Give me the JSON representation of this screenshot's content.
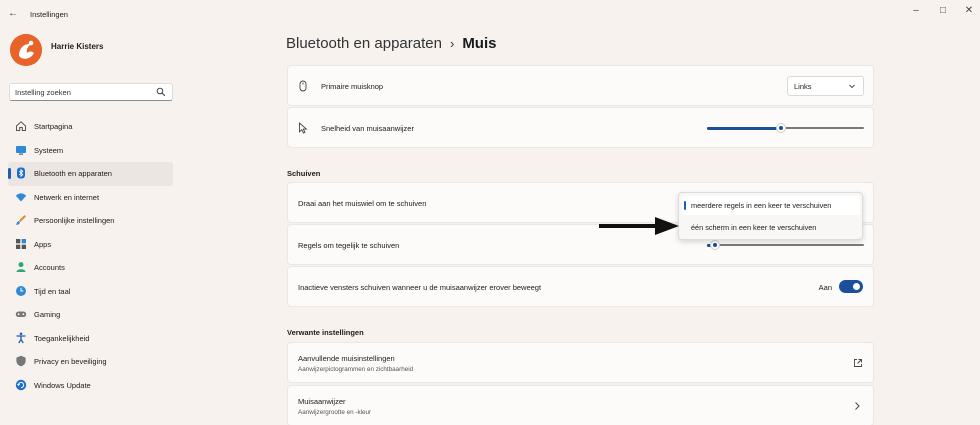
{
  "window": {
    "title": "Instellingen",
    "back_glyph": "←",
    "minimize_glyph": "–",
    "maximize_glyph": "□",
    "close_glyph": "✕"
  },
  "user": {
    "name": "Harrie Kisters"
  },
  "search": {
    "placeholder": "Instelling zoeken",
    "value": ""
  },
  "nav": {
    "items": [
      {
        "label": "Startpagina",
        "icon": "home-icon"
      },
      {
        "label": "Systeem",
        "icon": "monitor-icon"
      },
      {
        "label": "Bluetooth en apparaten",
        "icon": "bluetooth-icon",
        "active": true
      },
      {
        "label": "Netwerk en internet",
        "icon": "wifi-icon"
      },
      {
        "label": "Persoonlijke instellingen",
        "icon": "brush-icon"
      },
      {
        "label": "Apps",
        "icon": "apps-icon"
      },
      {
        "label": "Accounts",
        "icon": "person-icon"
      },
      {
        "label": "Tijd en taal",
        "icon": "globe-clock-icon"
      },
      {
        "label": "Gaming",
        "icon": "gamepad-icon"
      },
      {
        "label": "Toegankelijkheid",
        "icon": "accessibility-icon"
      },
      {
        "label": "Privacy en beveiliging",
        "icon": "shield-icon"
      },
      {
        "label": "Windows Update",
        "icon": "update-icon"
      }
    ]
  },
  "breadcrumb": {
    "parent": "Bluetooth en apparaten",
    "separator": "›",
    "current": "Muis"
  },
  "primary_button": {
    "label": "Primaire muisknop",
    "value": "Links",
    "icon": "mouse-icon"
  },
  "pointer_speed": {
    "label": "Snelheid van muisaanwijzer",
    "value": 0.47,
    "icon": "cursor-icon"
  },
  "scrolling": {
    "header": "Schuiven",
    "wheel_label": "Draai aan het muiswiel om te schuiven",
    "wheel_options": [
      "meerdere regels in een keer te verschuiven",
      "één scherm in een keer te verschuiven"
    ],
    "wheel_selected": 0,
    "lines_label": "Regels om tegelijk te schuiven",
    "lines_value": 0.05,
    "inactive_label": "Inactieve vensters schuiven wanneer u de muisaanwijzer erover beweegt",
    "inactive_state": "Aan",
    "inactive_on": true
  },
  "related": {
    "header": "Verwante instellingen",
    "items": [
      {
        "title": "Aanvullende muisinstellingen",
        "subtitle": "Aanwijzerpictogrammen en zichtbaarheid",
        "icon": "external-link-icon"
      },
      {
        "title": "Muisaanwijzer",
        "subtitle": "Aanwijzergrootte en -kleur",
        "icon": "chevron-right-icon"
      }
    ]
  },
  "colors": {
    "accent": "#1a4f9c",
    "selection": "#1a5fb4",
    "background": "#f7f2ee",
    "card": "#fdfbf9",
    "avatar": "#e8632a"
  }
}
